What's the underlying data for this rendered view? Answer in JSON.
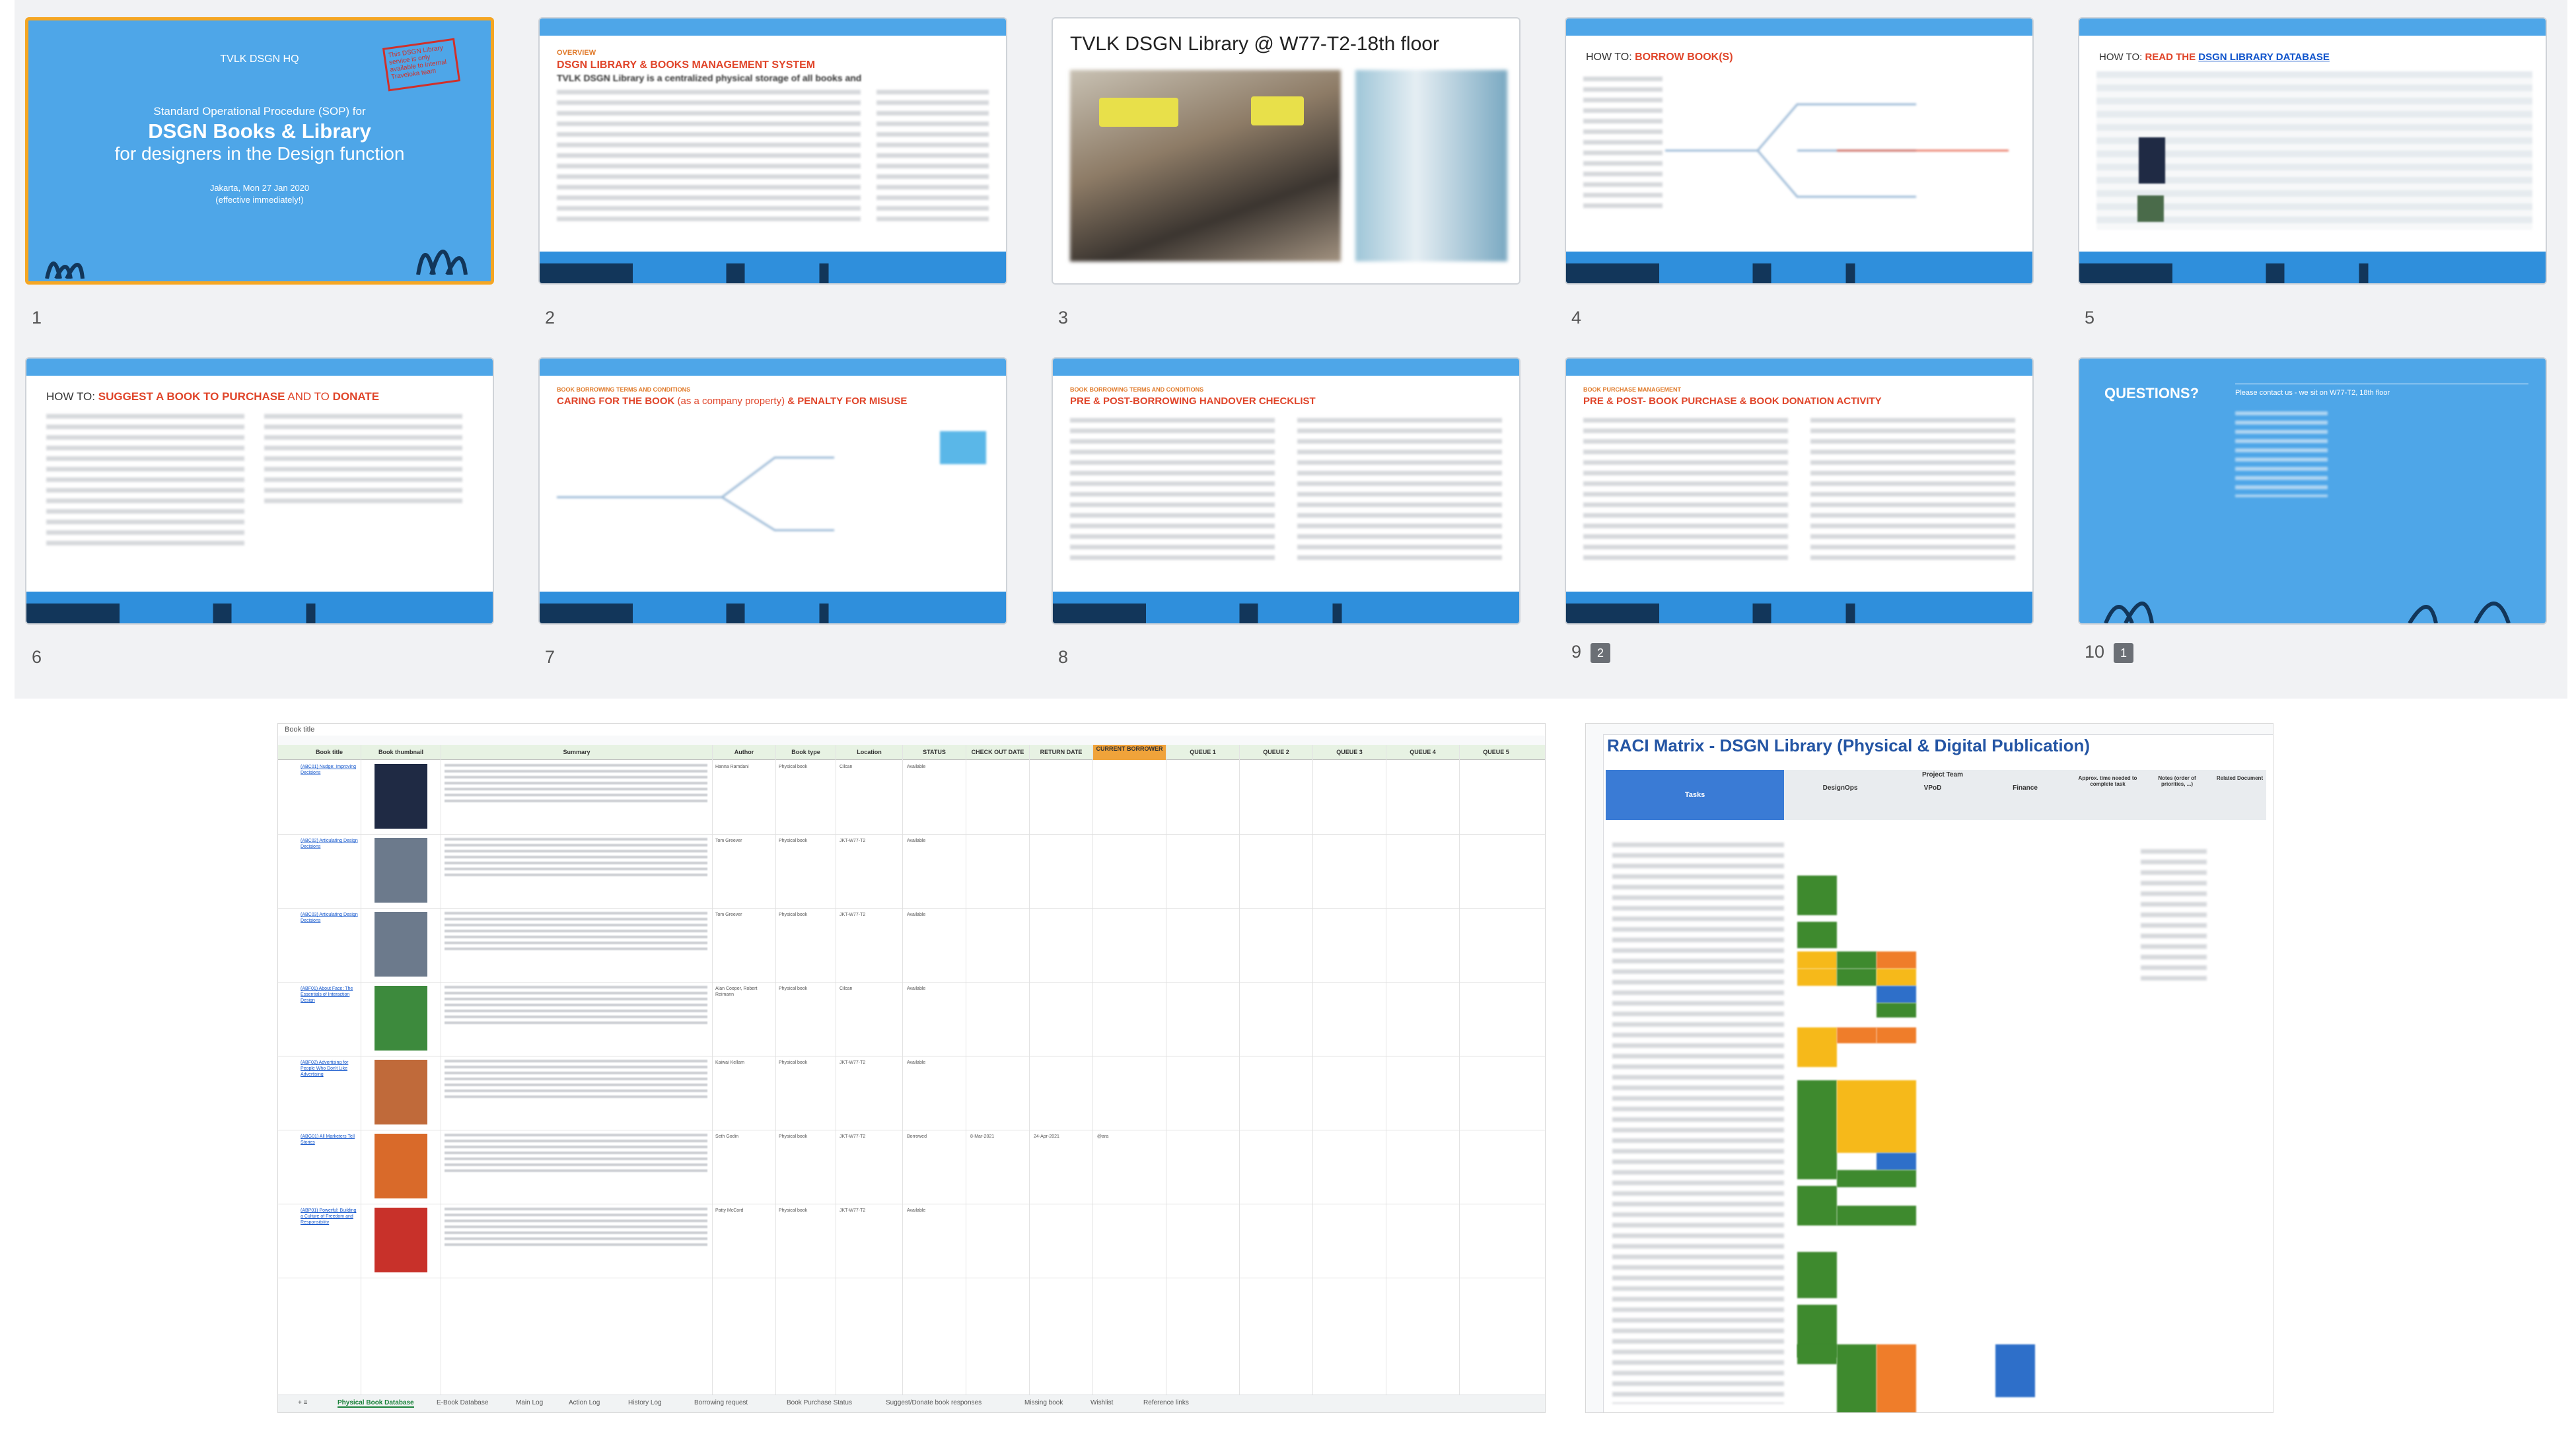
{
  "slides": [
    {
      "number": "1",
      "org": "TVLK DSGN HQ",
      "line1": "Standard Operational Procedure (SOP) for",
      "title_a": "DSGN Books & Library",
      "title_b": "for designers in the Design function",
      "date": "Jakarta, Mon 27 Jan 2020",
      "effective": "(effective immediately!)",
      "stamp": "This DSGN Library service is only available to internal Traveloka team"
    },
    {
      "number": "2",
      "kicker": "OVERVIEW",
      "heading": "DSGN LIBRARY & BOOKS MANAGEMENT SYSTEM",
      "sub": "TVLK DSGN Library is a centralized physical storage of all books and"
    },
    {
      "number": "3",
      "heading": "TVLK DSGN Library @ W77-T2-18th floor"
    },
    {
      "number": "4",
      "how": "HOW TO:",
      "heading": "BORROW BOOK(S)"
    },
    {
      "number": "5",
      "how": "HOW TO:",
      "heading_a": "READ THE",
      "heading_b": "DSGN LIBRARY DATABASE"
    },
    {
      "number": "6",
      "how": "HOW TO:",
      "heading_a": "SUGGEST A BOOK TO PURCHASE",
      "mid": "AND TO",
      "heading_b": "DONATE"
    },
    {
      "number": "7",
      "kicker": "BOOK BORROWING TERMS AND CONDITIONS",
      "heading_a": "CARING FOR THE BOOK",
      "mid": "(as a company property)",
      "heading_b": "& PENALTY FOR MISUSE"
    },
    {
      "number": "8",
      "kicker": "BOOK BORROWING TERMS AND CONDITIONS",
      "heading": "PRE & POST-BORROWING HANDOVER CHECKLIST"
    },
    {
      "number": "9",
      "kicker": "BOOK PURCHASE MANAGEMENT",
      "heading": "PRE & POST- BOOK PURCHASE & BOOK DONATION ACTIVITY",
      "comments": "2"
    },
    {
      "number": "10",
      "heading": "QUESTIONS?",
      "contact": "Please contact us - we sit on W77-T2, 18th floor",
      "comments": "1"
    }
  ],
  "sheet": {
    "formula_bar": "Book title",
    "headers": [
      "Book title",
      "Book thumbnail",
      "Summary",
      "Author",
      "Book type",
      "Location",
      "STATUS",
      "CHECK OUT DATE",
      "RETURN DATE",
      "CURRENT BORROWER",
      "QUEUE 1",
      "QUEUE 2",
      "QUEUE 3",
      "QUEUE 4",
      "QUEUE 5"
    ],
    "rows": [
      {
        "title": "(ABC01) Nudge: Improving Decisions",
        "author": "Hanna Ramdani",
        "type": "Physical book",
        "location": "Cilcan",
        "status": "Available",
        "cover": "#1f2a44"
      },
      {
        "title": "(ABC02) Articulating Design Decisions",
        "author": "Tom Greever",
        "type": "Physical book",
        "location": "JKT-W77-T2",
        "status": "Available",
        "cover": "#6c7a8c"
      },
      {
        "title": "(ABC03) Articulating Design Decisions",
        "author": "Tom Greever",
        "type": "Physical book",
        "location": "JKT-W77-T2",
        "status": "Available",
        "cover": "#6c7a8c"
      },
      {
        "title": "(ABF01) About Face: The Essentials of Interaction Design",
        "author": "Alan Cooper, Robert Reimann",
        "type": "Physical book",
        "location": "Cilcan",
        "status": "Available",
        "cover": "#3d8a3d"
      },
      {
        "title": "(ABF02) Advertising for People Who Don't Like Advertising",
        "author": "Kaiwai Kellam",
        "type": "Physical book",
        "location": "JKT-W77-T2",
        "status": "Available",
        "cover": "#c06a3a"
      },
      {
        "title": "(ABG01) All Marketers Tell Stories",
        "author": "Seth Godin",
        "type": "Physical book",
        "location": "JKT-W77-T2",
        "status": "Borrowed",
        "checkout": "8-Mar-2021",
        "return": "24-Apr-2021",
        "borrower": "@ara",
        "cover": "#d96a2a"
      },
      {
        "title": "(ABP01) Powerful: Building a Culture of Freedom and Responsibility",
        "author": "Patty McCord",
        "type": "Physical book",
        "location": "JKT-W77-T2",
        "status": "Available",
        "cover": "#c8312a"
      }
    ],
    "tabs": [
      "Physical Book Database",
      "E-Book Database",
      "Main Log",
      "Action Log",
      "History Log",
      "Borrowing request",
      "Book Purchase Status",
      "Suggest/Donate book responses",
      "Missing book",
      "Wishlist",
      "Reference links"
    ]
  },
  "raci": {
    "title": "RACI Matrix - DSGN Library (Physical & Digital Publication)",
    "group_header": "Project Team",
    "columns": [
      "Tasks",
      "DesignOps",
      "VPoD",
      "Finance",
      "Approx. time needed to complete task",
      "Notes (order of priorities, ...)",
      "Related Document"
    ]
  },
  "colors": {
    "slide_blue": "#4ea6e8",
    "accent_red": "#e0452a",
    "green": "#3e8a2e",
    "yellow": "#f6b91a",
    "orange": "#ef7d2a",
    "blue": "#2e6fc9",
    "selected_border": "#f5a623"
  }
}
